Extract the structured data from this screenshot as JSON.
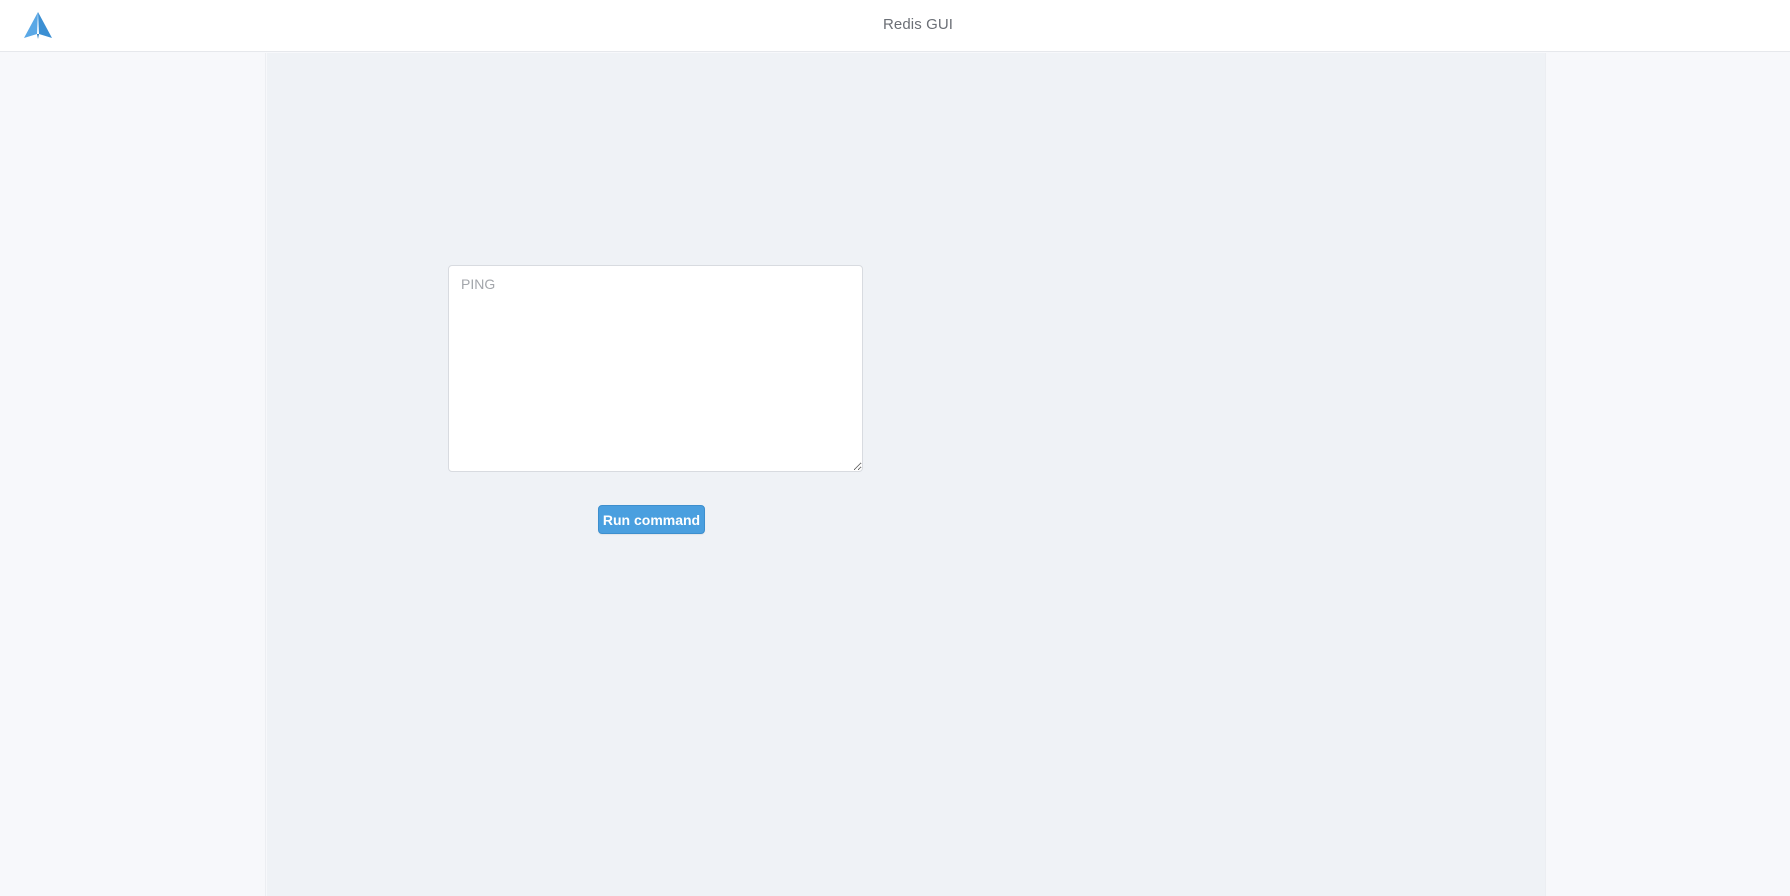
{
  "header": {
    "title": "Redis GUI",
    "logo_icon": "paper-plane-logo-icon"
  },
  "console": {
    "command_value": "",
    "command_placeholder": "PING",
    "run_label": "Run command"
  },
  "colors": {
    "accent": "#4a9fdf",
    "main_background": "#eff2f6",
    "side_background": "#f7f8fb",
    "header_background": "#ffffff"
  }
}
